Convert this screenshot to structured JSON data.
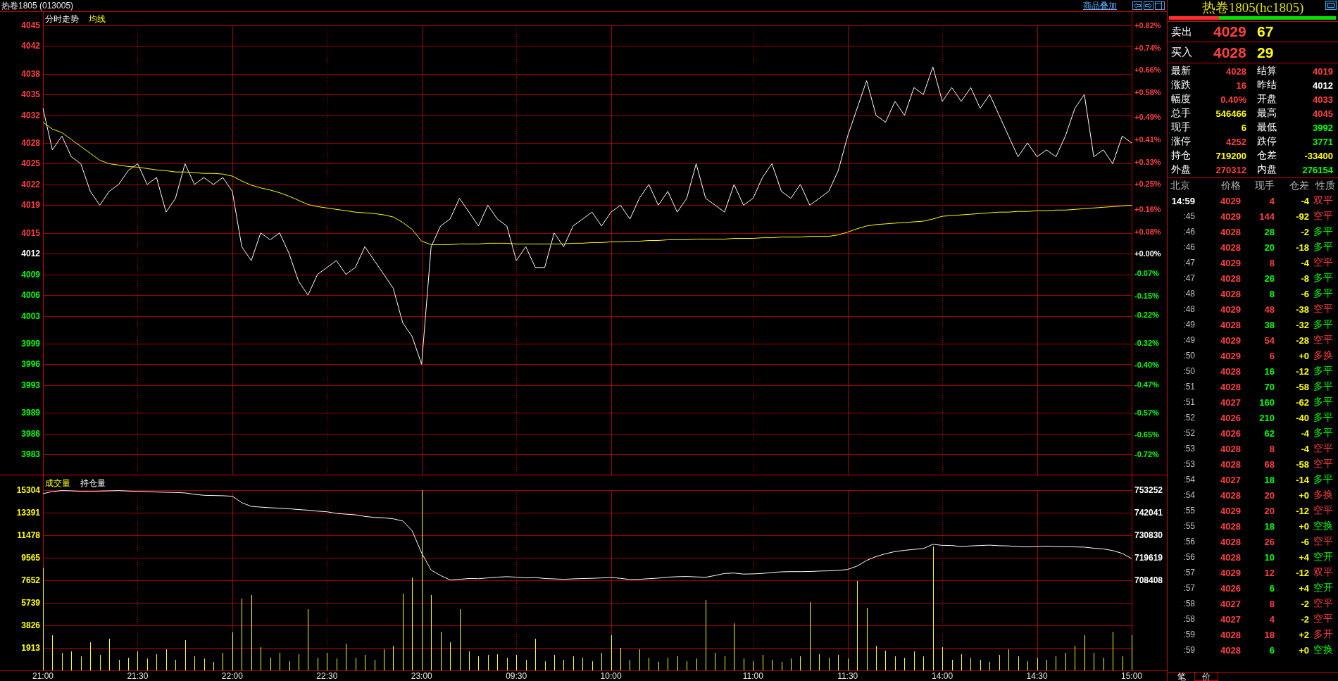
{
  "header": {
    "title": "热卷1805 (013005)",
    "overlay_link": "商品叠加"
  },
  "price_panel": {
    "chart_data": {
      "type": "line",
      "grid": true,
      "categories": [
        null,
        null,
        null,
        null,
        null,
        null,
        null,
        null,
        null,
        null,
        null,
        null,
        null,
        null,
        null,
        null,
        null,
        null,
        null,
        null,
        null,
        null,
        null,
        null,
        null,
        null,
        null,
        null,
        null,
        null,
        null,
        null,
        null,
        null,
        null,
        null,
        null,
        null,
        null,
        null,
        null,
        null,
        null,
        null,
        null,
        null,
        null,
        null,
        null,
        null,
        null,
        null,
        null,
        null,
        null,
        null,
        null,
        null,
        null,
        null,
        null,
        null,
        null,
        null,
        null,
        null,
        null,
        null,
        null,
        null,
        null,
        null,
        null,
        null,
        null,
        null,
        null,
        null,
        null,
        null,
        null,
        null,
        null,
        null,
        null,
        null,
        null,
        null,
        null,
        null,
        null,
        null,
        null,
        null,
        null,
        null,
        null,
        null,
        null,
        null,
        null,
        null,
        null,
        null,
        null,
        null,
        null,
        null,
        null,
        null,
        null,
        null,
        null,
        null,
        null,
        null
      ],
      "ylim": [
        3983,
        4045
      ],
      "y2lim": [
        -0.72,
        0.82
      ],
      "yticks": [
        {
          "value": 4045,
          "label": "4045"
        },
        {
          "value": 4042,
          "label": "4042"
        },
        {
          "value": 4038,
          "label": "4038"
        },
        {
          "value": 4035,
          "label": "4035"
        },
        {
          "value": 4032,
          "label": "4032"
        },
        {
          "value": 4028,
          "label": "4028"
        },
        {
          "value": 4025,
          "label": "4025"
        },
        {
          "value": 4022,
          "label": "4022"
        },
        {
          "value": 4019,
          "label": "4019"
        },
        {
          "value": 4015,
          "label": "4015"
        },
        {
          "value": 4012,
          "label": "4012"
        },
        {
          "value": 4009,
          "label": "4009"
        },
        {
          "value": 4006,
          "label": "4006"
        },
        {
          "value": 4003,
          "label": "4003"
        },
        {
          "value": 3999,
          "label": "3999"
        },
        {
          "value": 3996,
          "label": "3996"
        },
        {
          "value": 3993,
          "label": "3993"
        },
        {
          "value": 3989,
          "label": "3989"
        },
        {
          "value": 3986,
          "label": "3986"
        },
        {
          "value": 3983,
          "label": "3983"
        }
      ],
      "y2ticks": [
        {
          "value": 0.82,
          "label": "+0.82%"
        },
        {
          "value": 0.74,
          "label": "+0.74%"
        },
        {
          "value": 0.66,
          "label": "+0.66%"
        },
        {
          "value": 0.58,
          "label": "+0.58%"
        },
        {
          "value": 0.49,
          "label": "+0.49%"
        },
        {
          "value": 0.41,
          "label": "+0.41%"
        },
        {
          "value": 0.33,
          "label": "+0.33%"
        },
        {
          "value": 0.25,
          "label": "+0.25%"
        },
        {
          "value": 0.16,
          "label": "+0.16%"
        },
        {
          "value": 0.08,
          "label": "+0.08%"
        },
        {
          "value": 0,
          "label": "+0.00%"
        },
        {
          "value": -0.07,
          "label": "-0.07%"
        },
        {
          "value": -0.15,
          "label": "-0.15%"
        },
        {
          "value": -0.22,
          "label": "-0.22%"
        },
        {
          "value": -0.32,
          "label": "-0.32%"
        },
        {
          "value": -0.4,
          "label": "-0.40%"
        },
        {
          "value": -0.47,
          "label": "-0.47%"
        },
        {
          "value": -0.57,
          "label": "-0.57%"
        },
        {
          "value": -0.65,
          "label": "-0.65%"
        },
        {
          "value": -0.72,
          "label": "-0.72%"
        }
      ],
      "series": [
        {
          "name": "分时走势",
          "color": "#ffffff",
          "values": [
            4033,
            4027,
            4029,
            4026,
            4025,
            4021,
            4019,
            4021,
            4022,
            4024,
            4025,
            4022,
            4023,
            4018,
            4020,
            4025,
            4022,
            4023,
            4022,
            4023,
            4021,
            4013,
            4011,
            4015,
            4014,
            4015,
            4012,
            4008,
            4006,
            4009,
            4010,
            4011,
            4009,
            4010,
            4013,
            4011,
            4009,
            4007,
            4002,
            4000,
            3996,
            4013,
            4016,
            4017,
            4020,
            4018,
            4016,
            4019,
            4017,
            4016,
            4011,
            4013,
            4010,
            4010,
            4015,
            4013,
            4016,
            4017,
            4018,
            4016,
            4018,
            4019,
            4017,
            4020,
            4022,
            4019,
            4021,
            4018,
            4020,
            4025,
            4020,
            4019,
            4018,
            4022,
            4019,
            4020,
            4023,
            4025,
            4021,
            4020,
            4022,
            4019,
            4020,
            4021,
            4024,
            4029,
            4033,
            4037,
            4032,
            4031,
            4034,
            4032,
            4036,
            4035,
            4039,
            4034,
            4036,
            4034,
            4036,
            4033,
            4035,
            4032,
            4029,
            4026,
            4028,
            4026,
            4027,
            4026,
            4029,
            4033,
            4035,
            4026,
            4027,
            4025,
            4029,
            4028
          ]
        },
        {
          "name": "均线",
          "color": "#ffff00",
          "values": [
            4031,
            4030,
            4029.5,
            4028.5,
            4027.5,
            4026.5,
            4025.5,
            4025,
            4024.8,
            4024.6,
            4024.5,
            4024.3,
            4024.1,
            4024,
            4023.8,
            4023.8,
            4023.7,
            4023.6,
            4023.6,
            4023.5,
            4023.2,
            4022.5,
            4021.9,
            4021.5,
            4021.2,
            4020.8,
            4020.3,
            4019.7,
            4019.1,
            4018.8,
            4018.6,
            4018.4,
            4018.2,
            4018,
            4017.9,
            4017.8,
            4017.6,
            4017.3,
            4016.5,
            4015.5,
            4013.8,
            4013.3,
            4013.3,
            4013.3,
            4013.4,
            4013.4,
            4013.4,
            4013.5,
            4013.5,
            4013.5,
            4013.4,
            4013.4,
            4013.4,
            4013.4,
            4013.4,
            4013.4,
            4013.5,
            4013.5,
            4013.6,
            4013.6,
            4013.7,
            4013.7,
            4013.8,
            4013.8,
            4013.9,
            4013.9,
            4014,
            4014,
            4014,
            4014.1,
            4014.1,
            4014.1,
            4014.1,
            4014.2,
            4014.2,
            4014.2,
            4014.3,
            4014.3,
            4014.4,
            4014.4,
            4014.4,
            4014.5,
            4014.5,
            4014.5,
            4014.7,
            4015.1,
            4015.6,
            4016,
            4016.2,
            4016.3,
            4016.4,
            4016.5,
            4016.6,
            4016.7,
            4017,
            4017.4,
            4017.5,
            4017.6,
            4017.7,
            4017.8,
            4017.9,
            4018,
            4018,
            4018.1,
            4018.1,
            4018.2,
            4018.2,
            4018.3,
            4018.3,
            4018.4,
            4018.5,
            4018.6,
            4018.7,
            4018.8,
            4018.9,
            4019
          ]
        }
      ]
    }
  },
  "volume_panel": {
    "chart_data": {
      "type": "bar",
      "grid": true,
      "categories": [
        "21:00",
        null,
        null,
        null,
        null,
        null,
        null,
        null,
        null,
        null,
        "21:30",
        null,
        null,
        null,
        null,
        null,
        null,
        null,
        null,
        null,
        "22:00",
        null,
        null,
        null,
        null,
        null,
        null,
        null,
        null,
        null,
        "22:30",
        null,
        null,
        null,
        null,
        null,
        null,
        null,
        null,
        null,
        "23:00",
        null,
        null,
        null,
        null,
        null,
        null,
        null,
        null,
        null,
        "09:30",
        null,
        null,
        null,
        null,
        null,
        null,
        null,
        null,
        null,
        "10:00",
        null,
        null,
        null,
        null,
        null,
        null,
        null,
        null,
        null,
        null,
        null,
        null,
        null,
        null,
        "11:00",
        null,
        null,
        null,
        null,
        null,
        null,
        null,
        null,
        null,
        "11:30",
        null,
        null,
        null,
        null,
        null,
        null,
        null,
        null,
        null,
        "14:00",
        null,
        null,
        null,
        null,
        null,
        null,
        null,
        null,
        null,
        "14:30",
        null,
        null,
        null,
        null,
        null,
        null,
        null,
        null,
        null,
        "15:00"
      ],
      "ylim": [
        0,
        15304
      ],
      "yticks": [
        {
          "value": 15304,
          "label": "15304"
        },
        {
          "value": 13391,
          "label": "13391"
        },
        {
          "value": 11478,
          "label": "11478"
        },
        {
          "value": 9565,
          "label": "9565"
        },
        {
          "value": 7652,
          "label": "7652"
        },
        {
          "value": 5739,
          "label": "5739"
        },
        {
          "value": 3826,
          "label": "3826"
        },
        {
          "value": 1913,
          "label": "1913"
        }
      ],
      "series": [
        {
          "name": "成交量",
          "color": "#ffff00",
          "values": [
            8700,
            3000,
            1500,
            1600,
            1200,
            2400,
            1300,
            2700,
            900,
            1100,
            1600,
            1000,
            1400,
            1800,
            900,
            2600,
            1200,
            1000,
            700,
            1500,
            3200,
            6100,
            6400,
            2000,
            1100,
            1500,
            800,
            1400,
            5200,
            1100,
            1500,
            1000,
            2300,
            1100,
            1300,
            900,
            1800,
            2100,
            6500,
            7900,
            15300,
            6400,
            3300,
            2400,
            5200,
            1600,
            1200,
            1300,
            1400,
            1100,
            1300,
            900,
            2700,
            800,
            1300,
            900,
            1200,
            1100,
            800,
            1500,
            3000,
            1900,
            900,
            1800,
            1100,
            700,
            1100,
            1200,
            800,
            1000,
            6000,
            1500,
            1200,
            4000,
            1000,
            800,
            1300,
            900,
            700,
            1000,
            1200,
            5800,
            1400,
            1100,
            1300,
            1000,
            7600,
            5300,
            2100,
            1700,
            1200,
            1100,
            1600,
            1200,
            10500,
            2000,
            900,
            1400,
            1100,
            900,
            700,
            1300,
            1800,
            1200,
            800,
            1100,
            900,
            1200,
            1500,
            2100,
            3000,
            1500,
            1100,
            3300,
            1200,
            3000
          ]
        }
      ]
    }
  },
  "holdings_overlay": {
    "chart_data": {
      "type": "line",
      "categories": [
        null,
        null,
        null,
        null,
        null,
        null,
        null,
        null,
        null,
        null,
        null,
        null,
        null,
        null,
        null,
        null,
        null,
        null,
        null,
        null,
        null,
        null,
        null,
        null,
        null,
        null,
        null,
        null,
        null,
        null,
        null,
        null,
        null,
        null,
        null,
        null,
        null,
        null,
        null,
        null,
        null,
        null,
        null,
        null,
        null,
        null,
        null,
        null,
        null,
        null,
        null,
        null,
        null,
        null,
        null,
        null,
        null,
        null,
        null,
        null,
        null,
        null,
        null,
        null,
        null,
        null,
        null,
        null,
        null,
        null,
        null,
        null,
        null,
        null,
        null,
        null,
        null,
        null,
        null,
        null,
        null,
        null,
        null,
        null,
        null,
        null,
        null,
        null,
        null,
        null,
        null,
        null,
        null,
        null,
        null,
        null,
        null,
        null,
        null,
        null,
        null,
        null,
        null,
        null,
        null,
        null,
        null,
        null,
        null,
        null,
        null,
        null,
        null,
        null,
        null,
        null
      ],
      "ylim": [
        708408,
        753252
      ],
      "yticks": [
        {
          "value": 753252,
          "label": "753252"
        },
        {
          "value": 742041,
          "label": "742041"
        },
        {
          "value": 730830,
          "label": "730830"
        },
        {
          "value": 719619,
          "label": "719619"
        },
        {
          "value": 708408,
          "label": "708408"
        }
      ],
      "series": [
        {
          "name": "持仓量",
          "color": "#ffffff",
          "values": [
            751500,
            752600,
            753000,
            752900,
            752700,
            752600,
            752800,
            752900,
            753000,
            752800,
            752700,
            752500,
            752300,
            752200,
            752100,
            751900,
            751200,
            750700,
            750600,
            750500,
            750200,
            747000,
            745200,
            744800,
            744500,
            744300,
            744000,
            743600,
            743300,
            742800,
            742500,
            741700,
            741300,
            741000,
            740200,
            739700,
            739500,
            739000,
            737900,
            733000,
            722000,
            713500,
            710800,
            708600,
            708900,
            709300,
            709200,
            709600,
            710000,
            710200,
            710000,
            709600,
            709800,
            709300,
            709100,
            708900,
            709100,
            709300,
            709400,
            709600,
            709800,
            709400,
            708800,
            708900,
            709200,
            709500,
            710000,
            710200,
            710300,
            710100,
            709900,
            710800,
            711800,
            712000,
            711500,
            711600,
            711800,
            712300,
            712600,
            712700,
            712700,
            712800,
            713000,
            713100,
            713300,
            713800,
            715500,
            718300,
            720200,
            721600,
            722700,
            723300,
            723800,
            724200,
            726300,
            725800,
            725700,
            725200,
            725500,
            725700,
            725900,
            725600,
            725500,
            725200,
            725000,
            725200,
            725400,
            725200,
            725100,
            725000,
            724900,
            724400,
            724000,
            723200,
            721800,
            719200
          ]
        }
      ]
    }
  },
  "quote_panel": {
    "title": "热卷1805(hc1805)",
    "ratio_bar": {
      "level": 0.3
    },
    "ask": {
      "label": "卖出",
      "price": "4029",
      "volume": "67"
    },
    "bid": {
      "label": "买入",
      "price": "4028",
      "volume": "29"
    },
    "stats": [
      {
        "label": "最新",
        "value": "4028",
        "color": "#ff4040"
      },
      {
        "label": "结算",
        "value": "4019",
        "color": "#ff4040"
      },
      {
        "label": "涨跌",
        "value": "16",
        "color": "#ff4040"
      },
      {
        "label": "昨结",
        "value": "4012",
        "color": "#ffffff"
      },
      {
        "label": "幅度",
        "value": "0.40%",
        "color": "#ff4040"
      },
      {
        "label": "开盘",
        "value": "4033",
        "color": "#ff4040"
      },
      {
        "label": "总手",
        "value": "546466",
        "color": "#ffff00"
      },
      {
        "label": "最高",
        "value": "4045",
        "color": "#ff4040"
      },
      {
        "label": "现手",
        "value": "6",
        "color": "#ffff00"
      },
      {
        "label": "最低",
        "value": "3992",
        "color": "#00ff00"
      },
      {
        "label": "涨停",
        "value": "4252",
        "color": "#ff4040"
      },
      {
        "label": "跌停",
        "value": "3771",
        "color": "#00ff00"
      },
      {
        "label": "持仓",
        "value": "719200",
        "color": "#ffff00"
      },
      {
        "label": "仓差",
        "value": "-33400",
        "color": "#ffff00"
      },
      {
        "label": "外盘",
        "value": "270312",
        "color": "#ff4040"
      },
      {
        "label": "内盘",
        "value": "276154",
        "color": "#00ff00"
      }
    ],
    "trades": {
      "columns": [
        "北京",
        "价格",
        "现手",
        "仓差",
        "性质"
      ],
      "rows": [
        {
          "time": "14:59",
          "price": "4029",
          "volume": "4",
          "change": "-4",
          "nature": "双平",
          "color": "#ff4040"
        },
        {
          "time": ":45",
          "price": "4029",
          "volume": "144",
          "change": "-92",
          "nature": "空平",
          "color": "#ff4040"
        },
        {
          "time": ":46",
          "price": "4028",
          "volume": "28",
          "change": "-2",
          "nature": "多平",
          "color": "#00ff00"
        },
        {
          "time": ":46",
          "price": "4028",
          "volume": "20",
          "change": "-18",
          "nature": "多平",
          "color": "#00ff00"
        },
        {
          "time": ":47",
          "price": "4029",
          "volume": "8",
          "change": "-4",
          "nature": "空平",
          "color": "#ff4040"
        },
        {
          "time": ":47",
          "price": "4028",
          "volume": "26",
          "change": "-8",
          "nature": "多平",
          "color": "#00ff00"
        },
        {
          "time": ":48",
          "price": "4028",
          "volume": "8",
          "change": "-6",
          "nature": "多平",
          "color": "#00ff00"
        },
        {
          "time": ":48",
          "price": "4029",
          "volume": "48",
          "change": "-38",
          "nature": "空平",
          "color": "#ff4040"
        },
        {
          "time": ":49",
          "price": "4028",
          "volume": "38",
          "change": "-32",
          "nature": "多平",
          "color": "#00ff00"
        },
        {
          "time": ":49",
          "price": "4029",
          "volume": "54",
          "change": "-28",
          "nature": "空平",
          "color": "#ff4040"
        },
        {
          "time": ":50",
          "price": "4029",
          "volume": "6",
          "change": "+0",
          "nature": "多换",
          "color": "#ff4040"
        },
        {
          "time": ":50",
          "price": "4028",
          "volume": "16",
          "change": "-12",
          "nature": "多平",
          "color": "#00ff00"
        },
        {
          "time": ":51",
          "price": "4028",
          "volume": "70",
          "change": "-58",
          "nature": "多平",
          "color": "#00ff00"
        },
        {
          "time": ":51",
          "price": "4027",
          "volume": "160",
          "change": "-62",
          "nature": "多平",
          "color": "#00ff00"
        },
        {
          "time": ":52",
          "price": "4026",
          "volume": "210",
          "change": "-40",
          "nature": "多平",
          "color": "#00ff00"
        },
        {
          "time": ":52",
          "price": "4026",
          "volume": "62",
          "change": "-4",
          "nature": "多平",
          "color": "#00ff00"
        },
        {
          "time": ":53",
          "price": "4028",
          "volume": "8",
          "change": "-4",
          "nature": "空平",
          "color": "#ff4040"
        },
        {
          "time": ":53",
          "price": "4028",
          "volume": "68",
          "change": "-58",
          "nature": "空平",
          "color": "#ff4040"
        },
        {
          "time": ":54",
          "price": "4027",
          "volume": "18",
          "change": "-14",
          "nature": "多平",
          "color": "#00ff00"
        },
        {
          "time": ":54",
          "price": "4028",
          "volume": "20",
          "change": "+0",
          "nature": "多换",
          "color": "#ff4040"
        },
        {
          "time": ":55",
          "price": "4029",
          "volume": "20",
          "change": "-12",
          "nature": "空平",
          "color": "#ff4040"
        },
        {
          "time": ":55",
          "price": "4028",
          "volume": "18",
          "change": "+0",
          "nature": "空换",
          "color": "#00ff00"
        },
        {
          "time": ":56",
          "price": "4028",
          "volume": "26",
          "change": "-6",
          "nature": "空平",
          "color": "#ff4040"
        },
        {
          "time": ":56",
          "price": "4028",
          "volume": "10",
          "change": "+4",
          "nature": "空开",
          "color": "#00ff00"
        },
        {
          "time": ":57",
          "price": "4029",
          "volume": "12",
          "change": "-12",
          "nature": "双平",
          "color": "#ff4040"
        },
        {
          "time": ":57",
          "price": "4026",
          "volume": "6",
          "change": "+4",
          "nature": "空开",
          "color": "#00ff00"
        },
        {
          "time": ":58",
          "price": "4027",
          "volume": "8",
          "change": "-2",
          "nature": "空平",
          "color": "#ff4040"
        },
        {
          "time": ":58",
          "price": "4027",
          "volume": "4",
          "change": "-2",
          "nature": "空平",
          "color": "#ff4040"
        },
        {
          "time": ":59",
          "price": "4028",
          "volume": "18",
          "change": "+2",
          "nature": "多开",
          "color": "#ff4040"
        },
        {
          "time": ":59",
          "price": "4028",
          "volume": "6",
          "change": "+0",
          "nature": "空换",
          "color": "#00ff00"
        }
      ]
    },
    "tabs": [
      {
        "label": "笔",
        "selected": true
      },
      {
        "label": "价",
        "selected": false
      }
    ]
  }
}
